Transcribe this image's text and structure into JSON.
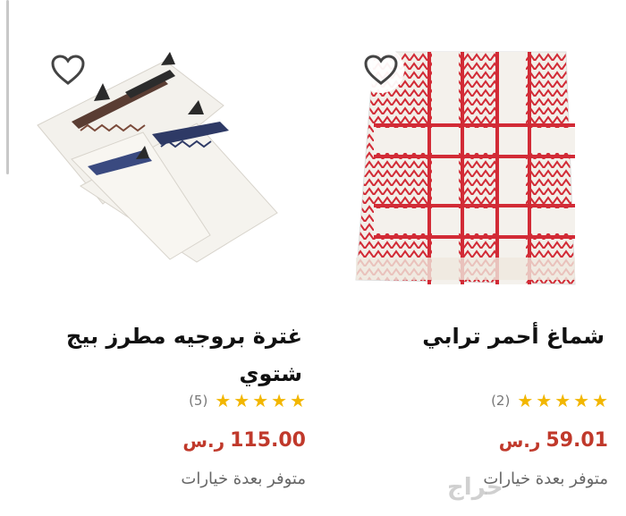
{
  "products": [
    {
      "title": "غترة بروجيه مطرز بيج شتوي",
      "rating_count": "(5)",
      "price": "115.00",
      "currency": "ر.س",
      "availability": "متوفر بعدة خيارات",
      "stars": 5,
      "image_icon": "embroidered-ghutra-image"
    },
    {
      "title": "شماغ أحمر ترابي",
      "rating_count": "(2)",
      "price": "59.01",
      "currency": "ر.س",
      "availability": "متوفر بعدة خيارات",
      "stars": 5,
      "image_icon": "red-shemagh-image"
    }
  ],
  "star_glyph": "★",
  "heart_icon": "heart-outline-icon",
  "watermark": "حراج",
  "colors": {
    "price": "#c0392b",
    "star": "#f2b600",
    "shemagh_red": "#d22b36"
  }
}
